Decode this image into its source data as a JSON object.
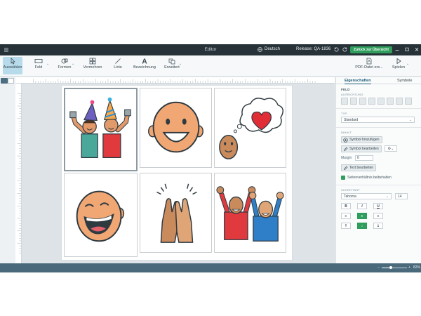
{
  "titlebar": {
    "title": "Editor",
    "language": "Deutsch",
    "release": "Release: QA-1836",
    "back_button": "Zurück zur Übersicht"
  },
  "toolbar": {
    "tools": [
      {
        "label": "Auswählen",
        "icon": "cursor-icon"
      },
      {
        "label": "Feld",
        "icon": "field-rectangle-icon"
      },
      {
        "label": "Formen",
        "icon": "shapes-icon"
      },
      {
        "label": "Vermehren",
        "icon": "grid-multiply-icon"
      },
      {
        "label": "Linie",
        "icon": "line-icon"
      },
      {
        "label": "Bezeichnung",
        "icon": "text-label-icon"
      },
      {
        "label": "Erweitert",
        "icon": "advanced-icon"
      }
    ],
    "pdf_label": "PDF-Datei ers...",
    "play_label": "Spielen"
  },
  "panel": {
    "tabs": [
      "Eigenschaften",
      "Symbole"
    ],
    "section_title": "FELD",
    "alignment_label": "AUSRICHTUNG",
    "type_label": "TYP",
    "type_value": "Standard",
    "content_label": "INHALT",
    "add_symbol": "Symbol hinzufügen",
    "edit_symbol": "Symbol bearbeiten",
    "margin_label": "Margin",
    "margin_value": "0",
    "edit_text": "Text bearbeiten",
    "keep_ratio": "Seitenverhältnis beibehalten",
    "font_label": "SCHRIFTART",
    "font_value": "Tahoma",
    "font_size": "14",
    "format_buttons": [
      "B",
      "I",
      "U"
    ]
  },
  "statusbar": {
    "zoom_label": "82%",
    "zoom_level": 0.35
  },
  "cells": [
    {
      "name": "symbol-party-cell"
    },
    {
      "name": "symbol-happy-face-cell"
    },
    {
      "name": "symbol-love-thought-cell"
    },
    {
      "name": "symbol-laughing-cell"
    },
    {
      "name": "symbol-high-five-cell"
    },
    {
      "name": "symbol-cheering-cell"
    }
  ]
}
